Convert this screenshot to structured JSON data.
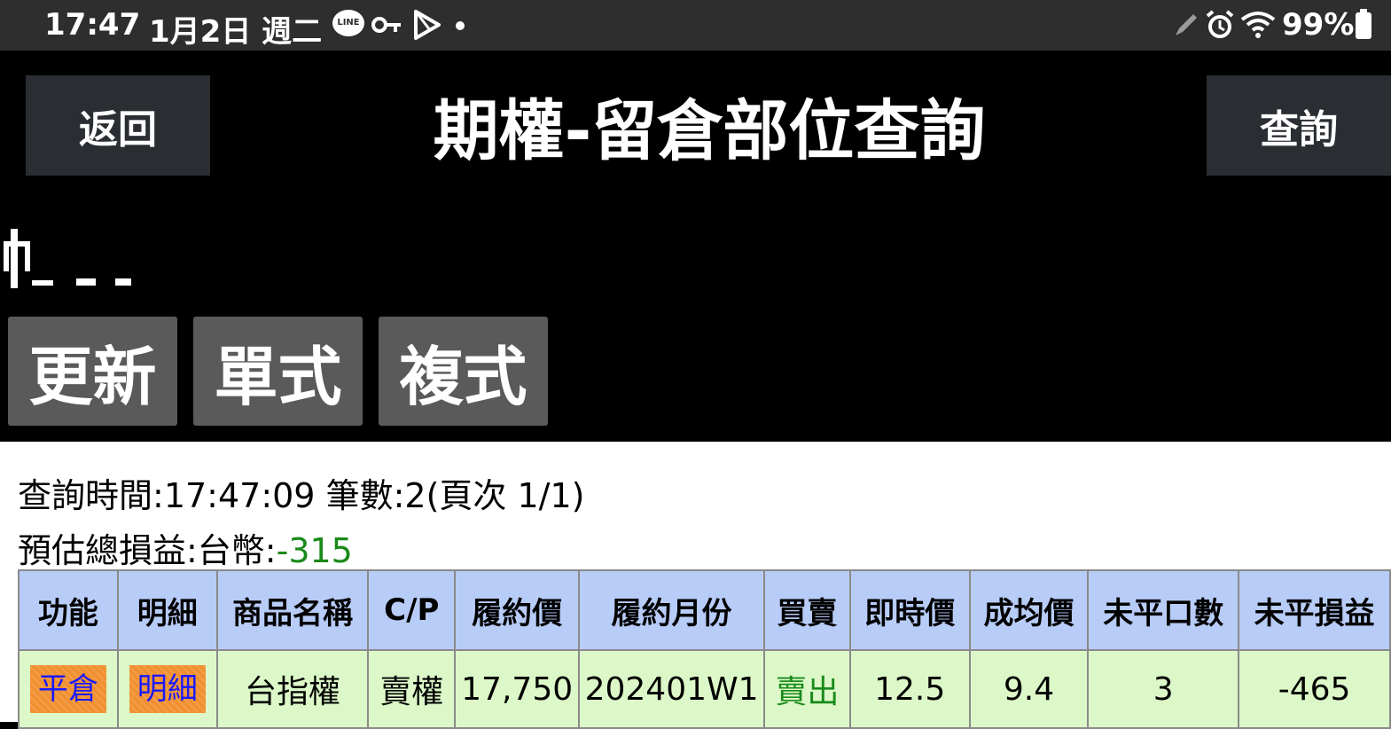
{
  "status_bar": {
    "time": "17:47",
    "date": "1月2日 週二",
    "line_label": "LINE",
    "battery": "99%",
    "icons": [
      "line-icon",
      "key-icon",
      "play-store-icon",
      "pen-icon",
      "alarm-icon",
      "wifi-icon",
      "battery-icon"
    ]
  },
  "header": {
    "back_label": "返回",
    "title": "期權-留倉部位查詢",
    "query_label": "查詢"
  },
  "actions": {
    "refresh_label": "更新",
    "single_label": "單式",
    "complex_label": "複式"
  },
  "summary": {
    "query_time_label": "查詢時間:",
    "query_time": "17:47:09",
    "count_label": " 筆數:",
    "count": "2",
    "page_label": "(頁次 1/1)",
    "pnl_label": "預估總損益:台幣:",
    "pnl_value": "-315"
  },
  "table": {
    "headers": [
      "功能",
      "明細",
      "商品名稱",
      "C/P",
      "履約價",
      "履約月份",
      "買賣",
      "即時價",
      "成均價",
      "未平口數",
      "未平損益"
    ],
    "rows": [
      {
        "function": "平倉",
        "detail": "明細",
        "product": "台指權",
        "cp": "賣權",
        "strike": "17,750",
        "month": "202401W1",
        "side": "賣出",
        "last_price": "12.5",
        "avg_price": "9.4",
        "open_qty": "3",
        "open_pnl": "-465"
      }
    ]
  },
  "colors": {
    "header_bg": "#b8ccf8",
    "row_bg": "#dcf8c8",
    "negative": "#1a8a1a",
    "action_orange": "#f09030",
    "button_gray": "#5a5a5a"
  }
}
